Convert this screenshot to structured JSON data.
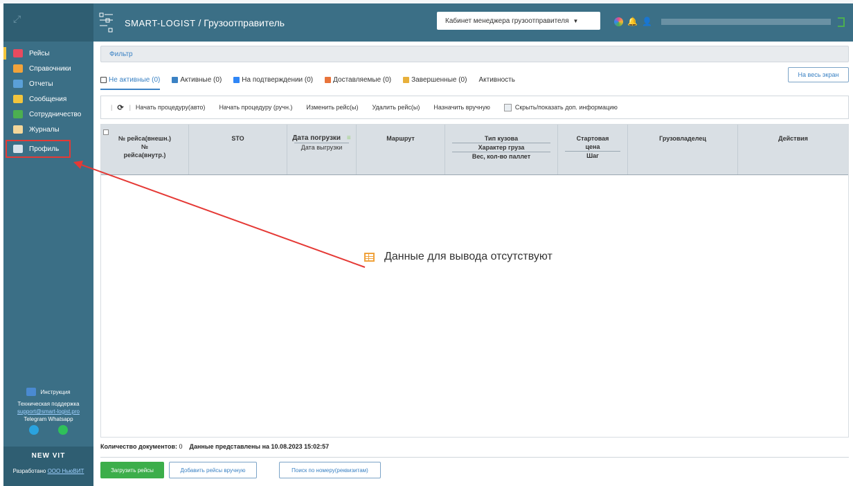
{
  "header": {
    "brand": "SMART-LOGIST",
    "page_title": "/ Грузоотправитель",
    "cabinet_select": "Кабинет менеджера грузоотправителя"
  },
  "sidebar": {
    "items": [
      {
        "label": "Рейсы",
        "color": "#e84a5f"
      },
      {
        "label": "Справочники",
        "color": "#f2a33a"
      },
      {
        "label": "Отчеты",
        "color": "#5aa0d8"
      },
      {
        "label": "Сообщения",
        "color": "#f2c53d"
      },
      {
        "label": "Сотрудничество",
        "color": "#4caf50"
      },
      {
        "label": "Журналы",
        "color": "#f3d79a"
      },
      {
        "label": "Профиль",
        "color": "#d8e2ea"
      }
    ],
    "instruction": "Инструкция",
    "support_label": "Техническая поддержка",
    "support_email": "support@smart-logist.pro",
    "messengers": "Telegram  Whatsapp",
    "footer_logo": "NEW VIT",
    "developed_by": "Разработано",
    "developer": "ООО НьюВИТ"
  },
  "filter": {
    "label": "Фильтр"
  },
  "tabs": [
    {
      "label": "Не активные (0)",
      "color": "#444444",
      "active": true
    },
    {
      "label": "Активные (0)",
      "color": "#3b82c4"
    },
    {
      "label": "На подтверждении (0)",
      "color": "#2f86f6"
    },
    {
      "label": "Доставляемые (0)",
      "color": "#e8743b"
    },
    {
      "label": "Завершенные (0)",
      "color": "#e8b03b"
    },
    {
      "label": "Активность",
      "color": null
    }
  ],
  "fullscreen_button": "На весь экран",
  "toolbar": {
    "start_auto": "Начать процедуру(авто)",
    "start_manual": "Начать процедуру (ручн.)",
    "edit_trip": "Изменить рейс(ы)",
    "delete_trip": "Удалить рейс(ы)",
    "assign_manual": "Назначить вручную",
    "toggle_info": "Скрыть/показать доп. информацию"
  },
  "table": {
    "columns": {
      "num_ext": "№ рейса(внешн.)",
      "num_int_prefix": "№",
      "num_int": "рейса(внутр.)",
      "sto": "STO",
      "load_date": "Дата погрузки",
      "unload_date": "Дата выгрузки",
      "route": "Маршрут",
      "body_type": "Тип кузова",
      "cargo_type": "Характер груза",
      "weight": "Вес, кол-во паллет",
      "start_price": "Стартовая цена",
      "step": "Шаг",
      "owner": "Грузовладелец",
      "actions": "Действия"
    },
    "empty_message": "Данные для вывода отсутствуют"
  },
  "footer": {
    "doc_count_label": "Количество документов:",
    "doc_count": "0",
    "data_as_of": "Данные представлены на 10.08.2023 15:02:57"
  },
  "buttons": {
    "upload": "Загрузить рейсы",
    "add_manual": "Добавить рейсы вручную",
    "search_by_number": "Поиск по номеру(реквизитам)"
  }
}
